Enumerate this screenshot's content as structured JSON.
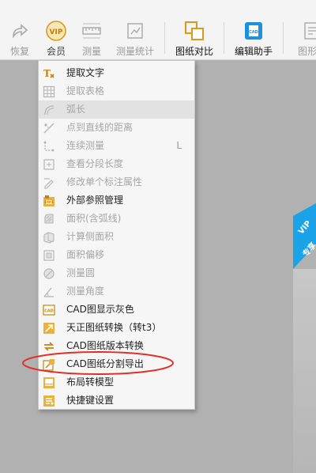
{
  "toolbar": {
    "items": [
      {
        "label": "恢复",
        "icon": "redo-icon",
        "state": "disabled"
      },
      {
        "label": "会员",
        "icon": "vip-icon",
        "badge": "VIP",
        "state": "normal"
      },
      {
        "label": "测量",
        "icon": "measure-ruler-icon",
        "state": "disabled"
      },
      {
        "label": "测量统计",
        "icon": "measure-statistics-icon",
        "state": "disabled"
      },
      {
        "label": "图纸对比",
        "icon": "drawing-compare-icon",
        "state": "active"
      },
      {
        "label": "编辑助手",
        "icon": "edit-assistant-icon",
        "state": "active"
      },
      {
        "label": "图形访",
        "icon": "graphic-icon",
        "state": "disabled"
      }
    ]
  },
  "menu": {
    "items": [
      {
        "label": "提取文字",
        "icon": "extract-text-icon",
        "enabled": true
      },
      {
        "label": "提取表格",
        "icon": "extract-table-icon",
        "enabled": false
      },
      {
        "label": "弧长",
        "icon": "arc-length-icon",
        "enabled": false,
        "hover": true
      },
      {
        "label": "点到直线的距离",
        "icon": "point-line-distance-icon",
        "enabled": false
      },
      {
        "label": "连续测量",
        "icon": "continuous-measure-icon",
        "enabled": false,
        "shortcut": "L"
      },
      {
        "label": "查看分段长度",
        "icon": "segment-length-icon",
        "enabled": false
      },
      {
        "label": "修改单个标注属性",
        "icon": "edit-annotation-icon",
        "enabled": false
      },
      {
        "label": "外部参照管理",
        "icon": "xref-manage-icon",
        "enabled": true
      },
      {
        "label": "面积(含弧线)",
        "icon": "area-arc-icon",
        "enabled": false
      },
      {
        "label": "计算侧面积",
        "icon": "side-area-icon",
        "enabled": false
      },
      {
        "label": "面积偏移",
        "icon": "area-offset-icon",
        "enabled": false
      },
      {
        "label": "测量圆",
        "icon": "measure-circle-icon",
        "enabled": false
      },
      {
        "label": "测量角度",
        "icon": "measure-angle-icon",
        "enabled": false
      },
      {
        "label": "CAD图显示灰色",
        "icon": "cad-gray-icon",
        "badge": "CAD",
        "enabled": true
      },
      {
        "label": "天正图纸转换（转t3）",
        "icon": "tangent-convert-icon",
        "enabled": true
      },
      {
        "label": "CAD图纸版本转换",
        "icon": "version-convert-icon",
        "enabled": true
      },
      {
        "label": "CAD图纸分割导出",
        "icon": "split-export-icon",
        "enabled": true,
        "circled": true
      },
      {
        "label": "布局转模型",
        "icon": "layout-model-icon",
        "enabled": true
      },
      {
        "label": "快捷键设置",
        "icon": "shortcut-settings-icon",
        "enabled": true
      }
    ]
  },
  "vip_ribbon": {
    "line1": "VIP",
    "line2": "专享"
  },
  "colors": {
    "accent_orange": "#d99a1c",
    "accent_blue": "#1e90e0",
    "ribbon_blue": "#1aa3e8",
    "highlight_red": "#e0302a"
  }
}
